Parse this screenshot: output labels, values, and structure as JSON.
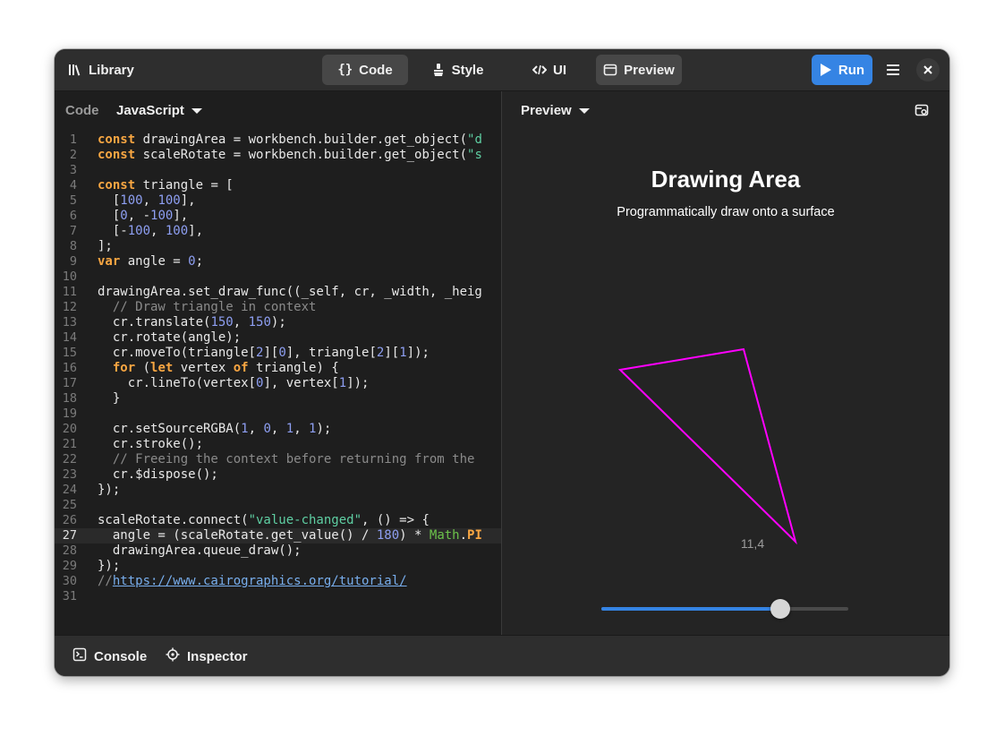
{
  "header": {
    "library_label": "Library",
    "tabs": [
      {
        "label": "Code",
        "active": true
      },
      {
        "label": "Style",
        "active": false
      },
      {
        "label": "UI",
        "active": false
      },
      {
        "label": "Preview",
        "active": true
      }
    ],
    "run_label": "Run"
  },
  "code_pane": {
    "label": "Code",
    "language": "JavaScript",
    "current_line": 27,
    "line_numbers": [
      "1",
      "2",
      "3",
      "4",
      "5",
      "6",
      "7",
      "8",
      "9",
      "10",
      "11",
      "12",
      "13",
      "14",
      "15",
      "16",
      "17",
      "18",
      "19",
      "20",
      "21",
      "22",
      "23",
      "24",
      "25",
      "26",
      "27",
      "28",
      "29",
      "30",
      "31"
    ],
    "lines": [
      "const drawingArea = workbench.builder.get_object(\"d",
      "const scaleRotate = workbench.builder.get_object(\"s",
      "",
      "const triangle = [",
      "  [100, 100],",
      "  [0, -100],",
      "  [-100, 100],",
      "];",
      "var angle = 0;",
      "",
      "drawingArea.set_draw_func((_self, cr, _width, _heig",
      "  // Draw triangle in context",
      "  cr.translate(150, 150);",
      "  cr.rotate(angle);",
      "  cr.moveTo(triangle[2][0], triangle[2][1]);",
      "  for (let vertex of triangle) {",
      "    cr.lineTo(vertex[0], vertex[1]);",
      "  }",
      "",
      "  cr.setSourceRGBA(1, 0, 1, 1);",
      "  cr.stroke();",
      "  // Freeing the context before returning from the",
      "  cr.$dispose();",
      "});",
      "",
      "scaleRotate.connect(\"value-changed\", () => {",
      "  angle = (scaleRotate.get_value() / 180) * Math.PI",
      "  drawingArea.queue_draw();",
      "});",
      "//https://www.cairographics.org/tutorial/",
      ""
    ]
  },
  "preview_pane": {
    "dropdown_label": "Preview",
    "title": "Drawing Area",
    "subtitle": "Programmatically draw onto a surface",
    "slider": {
      "value_text": "11,4",
      "fraction": 0.725
    },
    "triangle_stroke": "#ff00ff"
  },
  "bottom_bar": {
    "console_label": "Console",
    "inspector_label": "Inspector"
  },
  "colors": {
    "accent": "#3584e4",
    "keyword": "#f8a642",
    "number": "#8e9ff2",
    "string": "#5fcfa3",
    "comment": "#8a8a8a"
  }
}
